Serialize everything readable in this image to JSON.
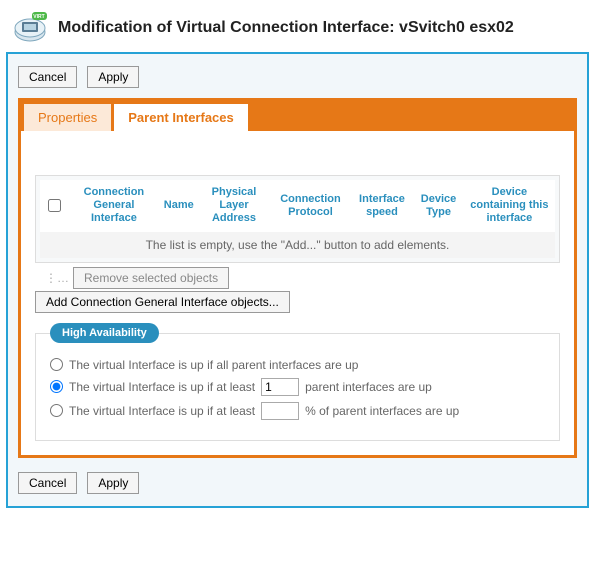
{
  "header": {
    "title": "Modification of Virtual Connection Interface: vSvitch0 esx02"
  },
  "buttons": {
    "cancel": "Cancel",
    "apply": "Apply",
    "remove": "Remove selected objects",
    "add": "Add Connection General Interface objects..."
  },
  "tabs": {
    "properties": "Properties",
    "parent": "Parent Interfaces"
  },
  "table": {
    "columns": [
      "Connection General Interface",
      "Name",
      "Physical Layer Address",
      "Connection Protocol",
      "Interface speed",
      "Device Type",
      "Device containing this interface"
    ],
    "empty_message": "The list is empty, use the \"Add...\" button to add elements."
  },
  "ha": {
    "title": "High Availability",
    "opt1": "The virtual Interface is up if all parent interfaces are up",
    "opt2_prefix": "The virtual Interface is up if at least",
    "opt2_suffix": "parent interfaces are up",
    "opt2_value": "1",
    "opt3_prefix": "The virtual Interface is up if at least",
    "opt3_suffix": "% of parent interfaces are up",
    "opt3_value": ""
  }
}
